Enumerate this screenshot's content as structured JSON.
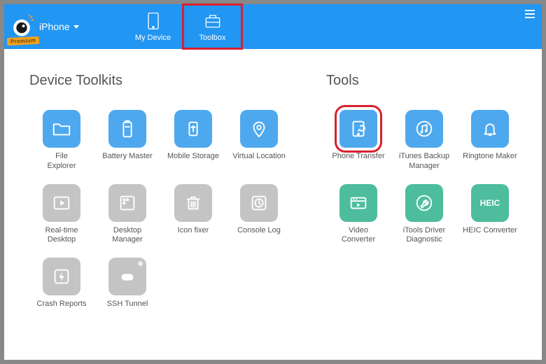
{
  "header": {
    "device_label": "iPhone",
    "premium_badge": "Premium",
    "tabs": [
      {
        "label": "My Device"
      },
      {
        "label": "Toolbox"
      }
    ]
  },
  "sections": {
    "left_title": "Device Toolkits",
    "right_title": "Tools"
  },
  "device_toolkits": [
    {
      "id": "file-explorer",
      "label": "File\nExplorer",
      "color": "blue",
      "icon": "folder"
    },
    {
      "id": "battery-master",
      "label": "Battery Master",
      "color": "blue",
      "icon": "battery"
    },
    {
      "id": "mobile-storage",
      "label": "Mobile Storage",
      "color": "blue",
      "icon": "usb"
    },
    {
      "id": "virtual-location",
      "label": "Virtual Location",
      "color": "blue",
      "icon": "pin"
    },
    {
      "id": "realtime-desktop",
      "label": "Real-time\nDesktop",
      "color": "gray",
      "icon": "play"
    },
    {
      "id": "desktop-manager",
      "label": "Desktop\nManager",
      "color": "gray",
      "icon": "grid"
    },
    {
      "id": "icon-fixer",
      "label": "Icon fixer",
      "color": "gray",
      "icon": "trash"
    },
    {
      "id": "console-log",
      "label": "Console Log",
      "color": "gray",
      "icon": "clock"
    },
    {
      "id": "crash-reports",
      "label": "Crash Reports",
      "color": "gray",
      "icon": "bolt"
    },
    {
      "id": "ssh-tunnel",
      "label": "SSH Tunnel",
      "color": "gray",
      "icon": "ssh"
    }
  ],
  "tools": [
    {
      "id": "phone-transfer",
      "label": "Phone Transfer",
      "color": "blue",
      "icon": "transfer",
      "highlighted": true
    },
    {
      "id": "itunes-backup",
      "label": "iTunes Backup\nManager",
      "color": "blue",
      "icon": "itunes"
    },
    {
      "id": "ringtone-maker",
      "label": "Ringtone Maker",
      "color": "blue",
      "icon": "bell"
    },
    {
      "id": "video-converter",
      "label": "Video\nConverter",
      "color": "green",
      "icon": "video"
    },
    {
      "id": "itools-driver",
      "label": "iTools Driver\nDiagnostic",
      "color": "green",
      "icon": "wrench"
    },
    {
      "id": "heic-converter",
      "label": "HEIC Converter",
      "color": "green",
      "icon": "heic"
    }
  ]
}
